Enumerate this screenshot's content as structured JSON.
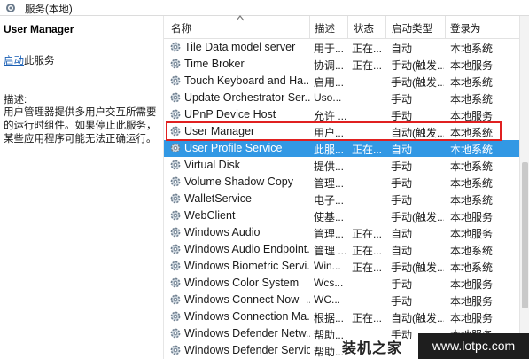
{
  "window": {
    "title": "服务(本地)"
  },
  "details": {
    "service_name": "User Manager",
    "start_link": "启动",
    "start_suffix": "此服务",
    "description_label": "描述:",
    "description": "用户管理器提供多用户交互所需要的运行时组件。如果停止此服务，某些应用程序可能无法正确运行。"
  },
  "table": {
    "columns": {
      "name": "名称",
      "description": "描述",
      "status": "状态",
      "startup": "启动类型",
      "logon": "登录为"
    },
    "selected_index": 6,
    "rows": [
      {
        "name": "Tile Data model server",
        "description": "用于...",
        "status": "正在...",
        "startup": "自动",
        "logon": "本地系统"
      },
      {
        "name": "Time Broker",
        "description": "协调...",
        "status": "正在...",
        "startup": "手动(触发...",
        "logon": "本地服务"
      },
      {
        "name": "Touch Keyboard and Ha...",
        "description": "启用...",
        "status": "",
        "startup": "手动(触发...",
        "logon": "本地系统"
      },
      {
        "name": "Update Orchestrator Ser...",
        "description": "Uso...",
        "status": "",
        "startup": "手动",
        "logon": "本地系统"
      },
      {
        "name": "UPnP Device Host",
        "description": "允许 ...",
        "status": "",
        "startup": "手动",
        "logon": "本地服务"
      },
      {
        "name": "User Manager",
        "description": "用户...",
        "status": "",
        "startup": "自动(触发...",
        "logon": "本地系统"
      },
      {
        "name": "User Profile Service",
        "description": "此服...",
        "status": "正在...",
        "startup": "自动",
        "logon": "本地系统"
      },
      {
        "name": "Virtual Disk",
        "description": "提供...",
        "status": "",
        "startup": "手动",
        "logon": "本地系统"
      },
      {
        "name": "Volume Shadow Copy",
        "description": "管理...",
        "status": "",
        "startup": "手动",
        "logon": "本地系统"
      },
      {
        "name": "WalletService",
        "description": "电子...",
        "status": "",
        "startup": "手动",
        "logon": "本地系统"
      },
      {
        "name": "WebClient",
        "description": "使基...",
        "status": "",
        "startup": "手动(触发...",
        "logon": "本地服务"
      },
      {
        "name": "Windows Audio",
        "description": "管理...",
        "status": "正在...",
        "startup": "自动",
        "logon": "本地服务"
      },
      {
        "name": "Windows Audio Endpoint...",
        "description": "管理 ...",
        "status": "正在...",
        "startup": "自动",
        "logon": "本地系统"
      },
      {
        "name": "Windows Biometric Servi...",
        "description": "Win...",
        "status": "正在...",
        "startup": "手动(触发...",
        "logon": "本地系统"
      },
      {
        "name": "Windows Color System",
        "description": "Wcs...",
        "status": "",
        "startup": "手动",
        "logon": "本地服务"
      },
      {
        "name": "Windows Connect Now -...",
        "description": "WC...",
        "status": "",
        "startup": "手动",
        "logon": "本地服务"
      },
      {
        "name": "Windows Connection Ma...",
        "description": "根据...",
        "status": "正在...",
        "startup": "自动(触发...",
        "logon": "本地服务"
      },
      {
        "name": "Windows Defender Netw...",
        "description": "帮助...",
        "status": "",
        "startup": "手动",
        "logon": "本地服务"
      },
      {
        "name": "Windows Defender Service",
        "description": "帮助...",
        "status": "",
        "startup": "",
        "logon": ""
      }
    ]
  },
  "watermark": {
    "brand": "装机之家",
    "url": "www.lotpc.com"
  },
  "colors": {
    "selection": "#3298e4",
    "highlight_border": "#e02020",
    "link": "#1a5fb4"
  }
}
